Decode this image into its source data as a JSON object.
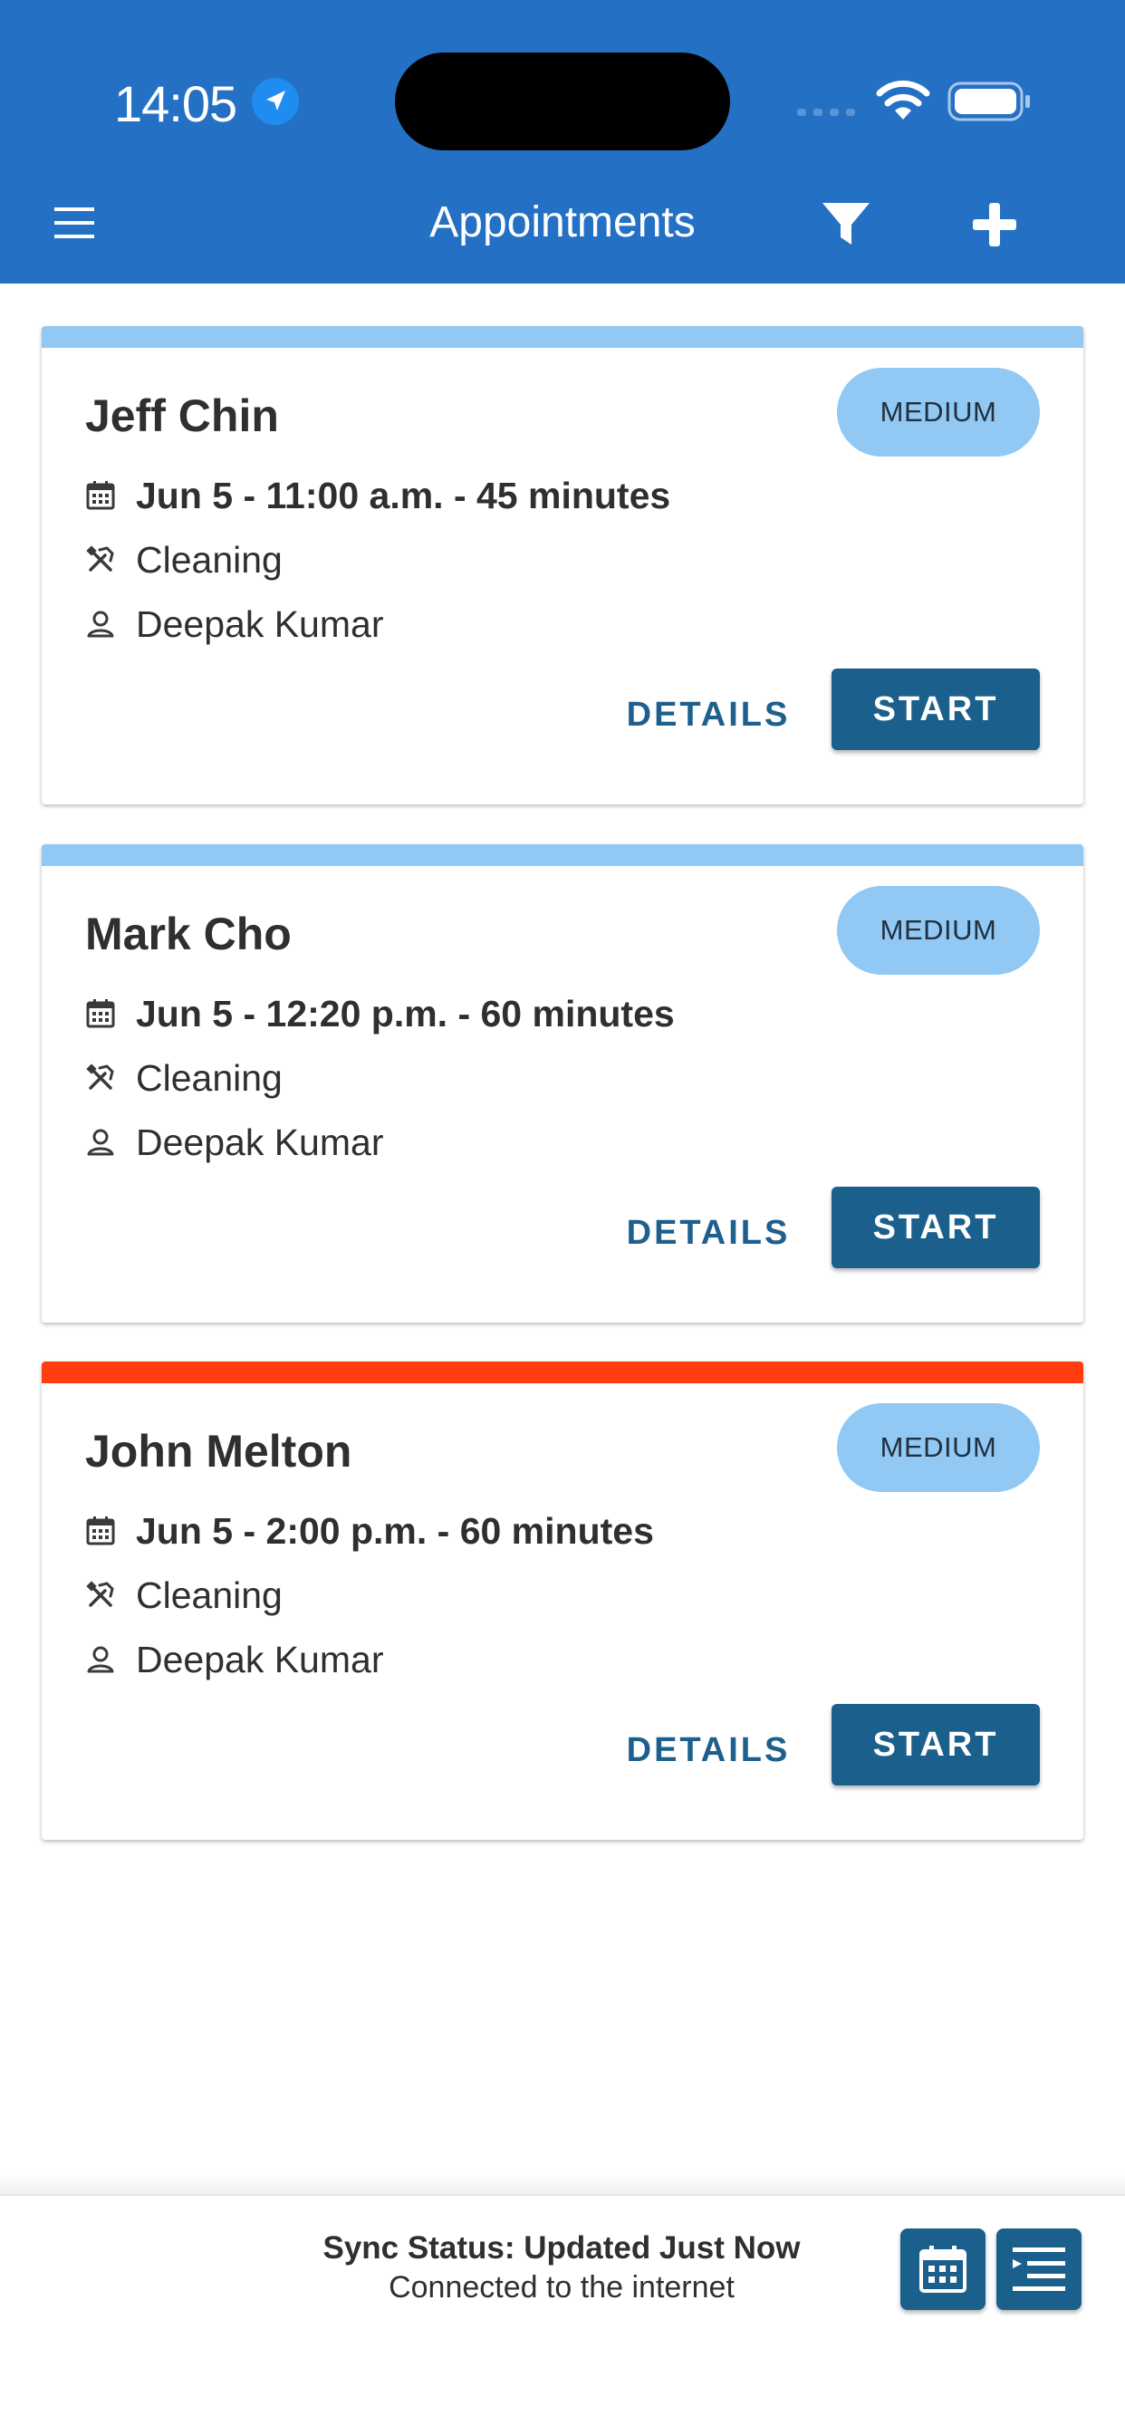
{
  "status_bar": {
    "time": "14:05",
    "icons": [
      "location-arrow-icon",
      "signal-icon",
      "wifi-icon",
      "battery-icon"
    ]
  },
  "header": {
    "title": "Appointments",
    "menu_icon": "hamburger-menu-icon",
    "filter_icon": "filter-icon",
    "add_icon": "plus-icon",
    "background": "#2470c4"
  },
  "appointments": [
    {
      "name": "Jeff Chin",
      "priority": "MEDIUM",
      "datetime": "Jun 5 - 11:00 a.m. - 45 minutes",
      "service": "Cleaning",
      "provider": "Deepak Kumar",
      "accent_color": "#91c9f4",
      "details_label": "DETAILS",
      "start_label": "START"
    },
    {
      "name": "Mark Cho",
      "priority": "MEDIUM",
      "datetime": "Jun 5 - 12:20 p.m. - 60 minutes",
      "service": "Cleaning",
      "provider": "Deepak Kumar",
      "accent_color": "#91c9f4",
      "details_label": "DETAILS",
      "start_label": "START"
    },
    {
      "name": "John Melton",
      "priority": "MEDIUM",
      "datetime": "Jun 5 - 2:00 p.m. - 60 minutes",
      "service": "Cleaning",
      "provider": "Deepak Kumar",
      "accent_color": "#ff3d0e",
      "details_label": "DETAILS",
      "start_label": "START"
    }
  ],
  "footer": {
    "sync_status": "Sync Status: Updated Just Now",
    "connection": "Connected to the internet",
    "calendar_icon": "calendar-icon",
    "list_icon": "list-view-icon"
  }
}
